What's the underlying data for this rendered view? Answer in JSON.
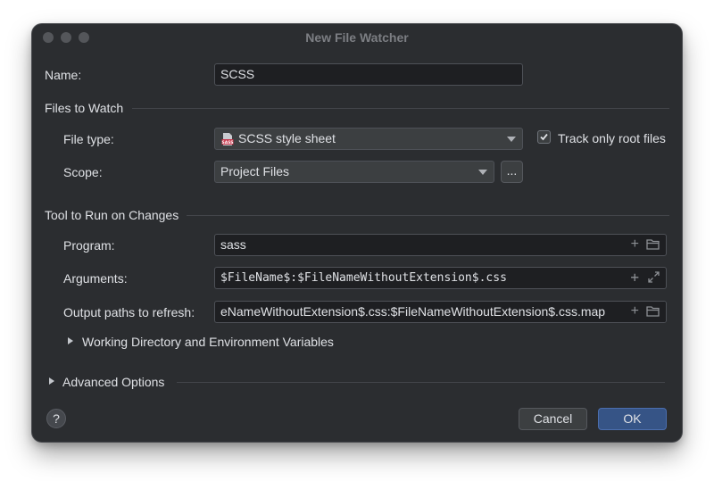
{
  "dialog": {
    "title": "New File Watcher",
    "name_label": "Name:",
    "name_value": "SCSS",
    "files_section": "Files to Watch",
    "file_type_label": "File type:",
    "file_type_value": "SCSS style sheet",
    "file_type_icon": "sass-file-icon",
    "track_label": "Track only root files",
    "track_checked": true,
    "scope_label": "Scope:",
    "scope_value": "Project Files",
    "scope_more": "...",
    "tool_section": "Tool to Run on Changes",
    "program_label": "Program:",
    "program_value": "sass",
    "arguments_label": "Arguments:",
    "arguments_value": "$FileName$:$FileNameWithoutExtension$.css",
    "output_label": "Output paths to refresh:",
    "output_value": "eNameWithoutExtension$.css:$FileNameWithoutExtension$.css.map",
    "working_dir": "Working Directory and Environment Variables",
    "advanced": "Advanced Options",
    "help": "?",
    "cancel": "Cancel",
    "ok": "OK"
  },
  "colors": {
    "window_bg": "#2b2d30",
    "field_bg": "#1e1f22",
    "ok_button": "#365486"
  }
}
